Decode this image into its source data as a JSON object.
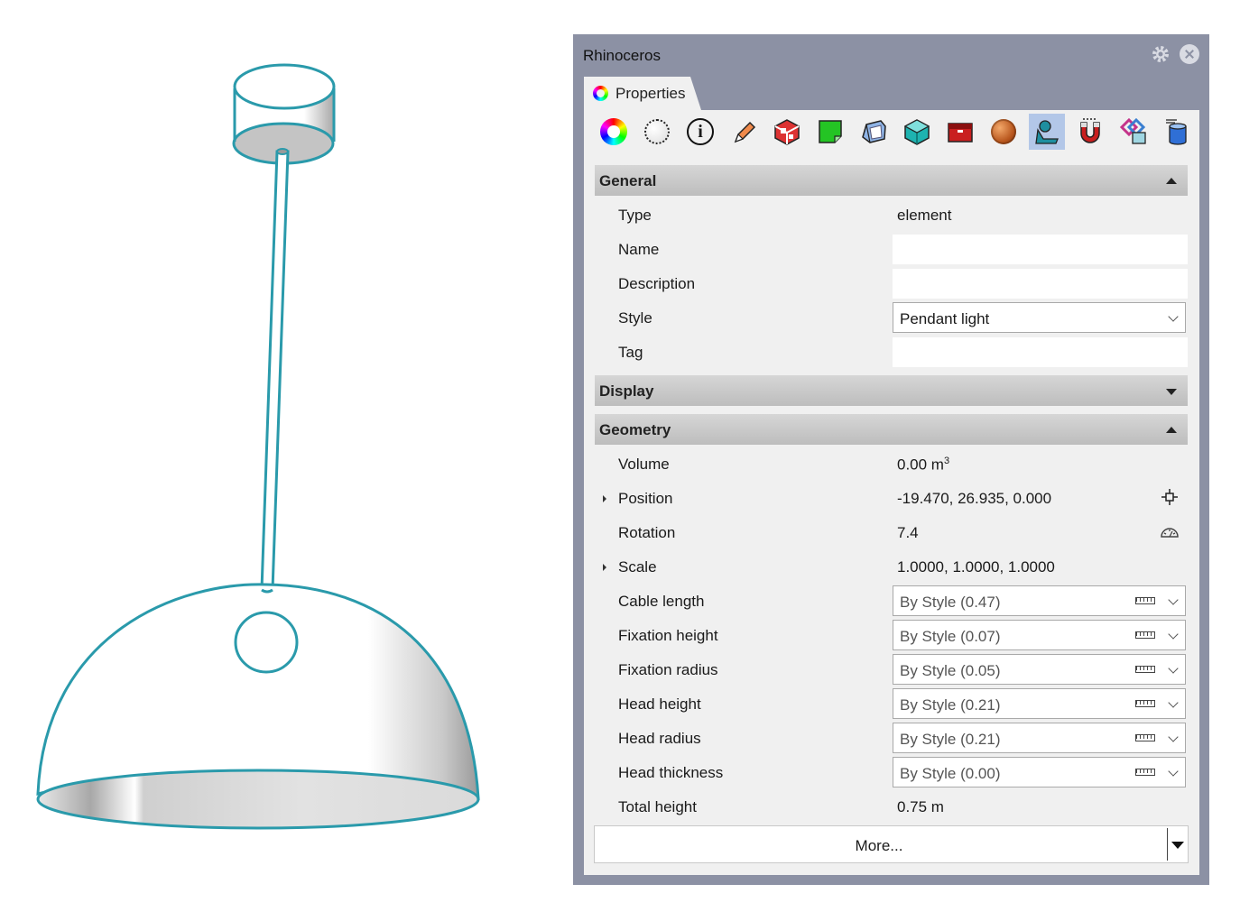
{
  "window": {
    "title": "Rhinoceros"
  },
  "tab": {
    "label": "Properties"
  },
  "toolbar": {
    "icons": [
      "color-wheel-icon",
      "material-circle-icon",
      "info-icon",
      "pencil-icon",
      "render-cube-icon",
      "green-page-icon",
      "mesh-cube-icon",
      "teal-cube-icon",
      "red-box-icon",
      "sphere-texture-icon",
      "person-icon",
      "magnet-icon",
      "linked-blocks-icon",
      "database-icon"
    ],
    "active_index": 10
  },
  "sections": {
    "general": {
      "label": "General"
    },
    "display": {
      "label": "Display"
    },
    "geometry": {
      "label": "Geometry"
    }
  },
  "general": {
    "type_label": "Type",
    "type_value": "element",
    "name_label": "Name",
    "name_value": "",
    "description_label": "Description",
    "description_value": "",
    "style_label": "Style",
    "style_value": "Pendant light",
    "tag_label": "Tag",
    "tag_value": ""
  },
  "geometry": {
    "volume_label": "Volume",
    "volume_value": "0.00 m",
    "volume_exp": "3",
    "position_label": "Position",
    "position_value": "-19.470, 26.935, 0.000",
    "rotation_label": "Rotation",
    "rotation_value": "7.4",
    "scale_label": "Scale",
    "scale_value": "1.0000, 1.0000, 1.0000",
    "cable_length_label": "Cable length",
    "cable_length_value": "By Style (0.47)",
    "fixation_height_label": "Fixation height",
    "fixation_height_value": "By Style (0.07)",
    "fixation_radius_label": "Fixation radius",
    "fixation_radius_value": "By Style (0.05)",
    "head_height_label": "Head height",
    "head_height_value": "By Style (0.21)",
    "head_radius_label": "Head radius",
    "head_radius_value": "By Style (0.21)",
    "head_thickness_label": "Head thickness",
    "head_thickness_value": "By Style (0.00)",
    "total_height_label": "Total height",
    "total_height_value": "0.75 m"
  },
  "more": {
    "label": "More..."
  },
  "colors": {
    "panel_frame": "#8c91a4",
    "outline": "#2a9aab",
    "active_tool": "#b3c7e8"
  }
}
